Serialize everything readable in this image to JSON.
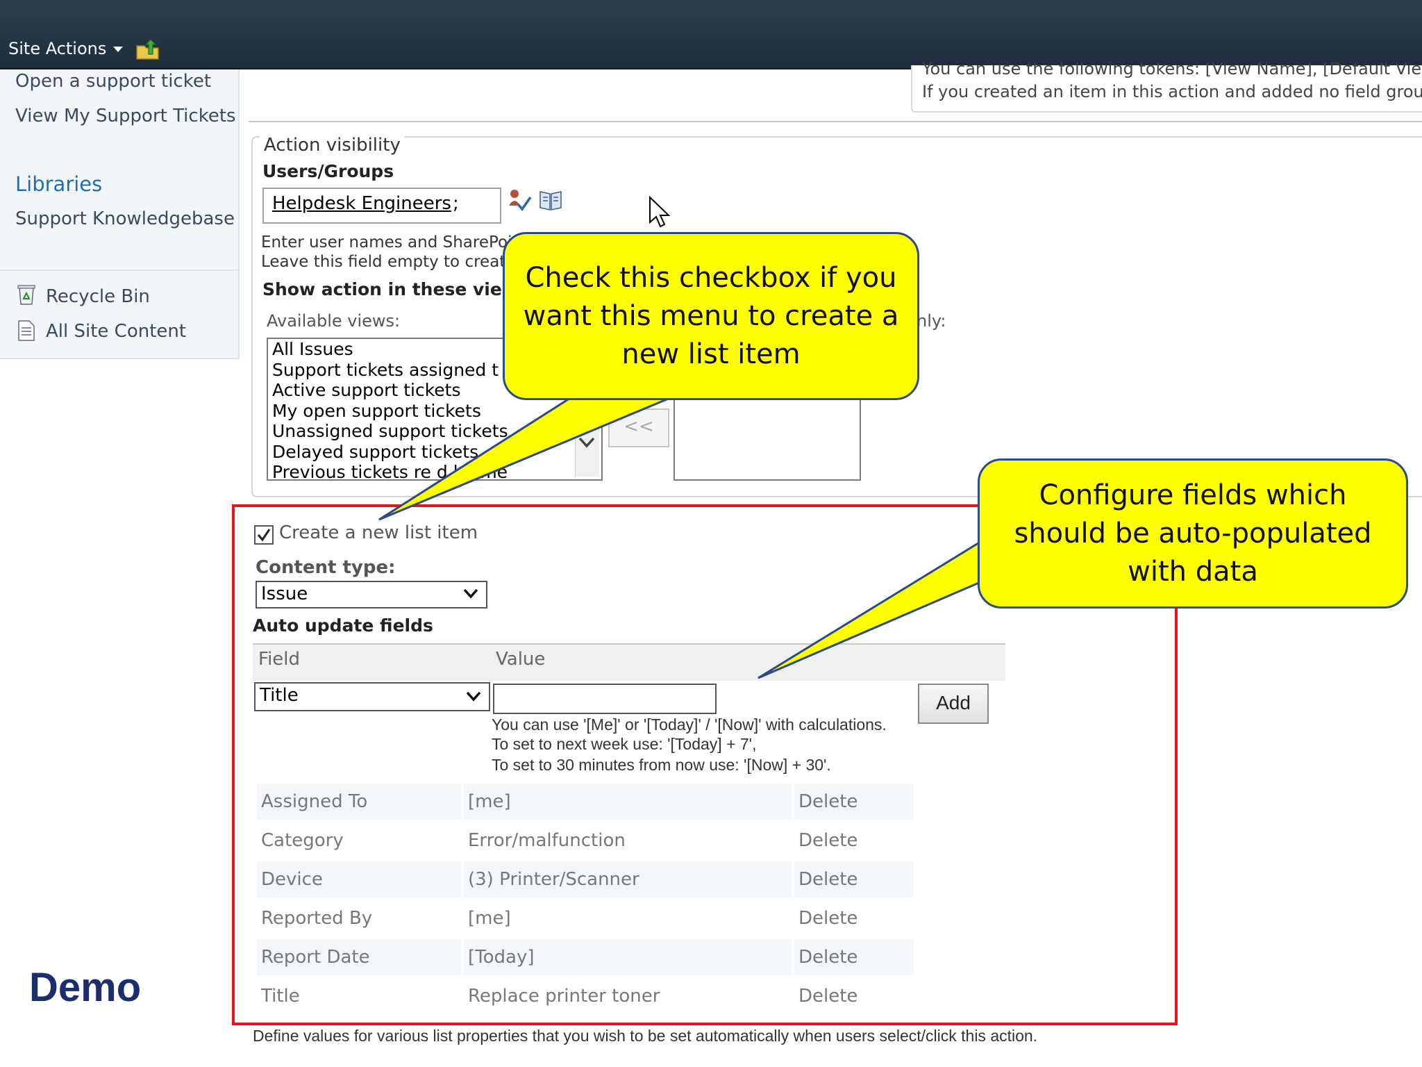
{
  "topbar": {
    "site_actions_label": "Site Actions"
  },
  "nav": {
    "links": [
      "Open a support ticket",
      "View My Support Tickets"
    ],
    "libraries_heading": "Libraries",
    "library_links": [
      "Support Knowledgebase"
    ],
    "recycle_bin": "Recycle Bin",
    "all_site_content": "All Site Content"
  },
  "tokens": {
    "line1": "You can use the following tokens: [View Name], [Default View], [Ho",
    "line2": "If you created an item in this action and added no field groups, you"
  },
  "visibility": {
    "legend": "Action visibility",
    "users_groups_label": "Users/Groups",
    "users_value": "Helpdesk Engineers",
    "users_separator": ";",
    "hint1": "Enter user names and SharePoint",
    "hint2": "Leave this field empty to create",
    "views_label": "Show action in these views",
    "available_views_label": "Available views:",
    "selected_only_fragment": "nly:",
    "available_views": [
      "All Issues",
      "Support tickets assigned t",
      "Active support tickets",
      "My open support tickets",
      "Unassigned support tickets",
      "Delayed support tickets",
      "Previous tickets re       d by me"
    ],
    "remove_button_label": "<<"
  },
  "create_item": {
    "checkbox_checked": true,
    "checkbox_label": "Create a new list item",
    "content_type_label": "Content type:",
    "content_type_value": "Issue",
    "auto_update_label": "Auto update fields",
    "field_header": "Field",
    "value_header": "Value",
    "field_select_value": "Title",
    "value_input": "",
    "add_button_label": "Add",
    "help_lines": [
      "You can use '[Me]' or '[Today]' / '[Now]' with calculations.",
      "To set to next week use: '[Today] + 7',",
      "To set to 30 minutes from now use: '[Now] + 30'."
    ],
    "rows": [
      {
        "field": "Assigned To",
        "value": "[me]",
        "action": "Delete"
      },
      {
        "field": "Category",
        "value": "Error/malfunction",
        "action": "Delete"
      },
      {
        "field": "Device",
        "value": "(3) Printer/Scanner",
        "action": "Delete"
      },
      {
        "field": "Reported By",
        "value": "[me]",
        "action": "Delete"
      },
      {
        "field": "Report Date",
        "value": "[Today]",
        "action": "Delete"
      },
      {
        "field": "Title",
        "value": "Replace printer toner",
        "action": "Delete"
      }
    ],
    "define_text": "Define values for various list properties that you wish to be set automatically when users select/click this action."
  },
  "callouts": {
    "checkbox_callout": "Check this checkbox if you want this menu to create a new list item",
    "fields_callout": "Configure fields which should be auto-populated with data"
  },
  "demo_label": "Demo",
  "colors": {
    "callout_fill": "#ffff00",
    "highlight_border": "#e8141c",
    "topbar": "#24354a",
    "demo_text": "#1c2e6e"
  }
}
